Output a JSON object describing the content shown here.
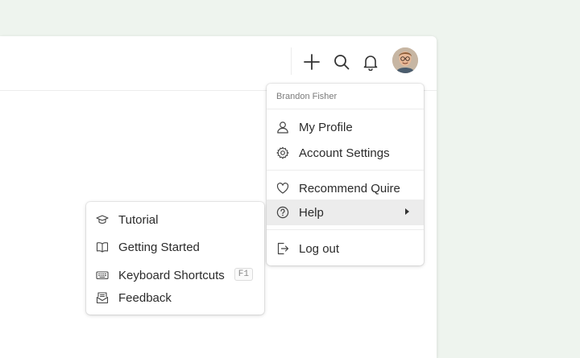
{
  "header": {
    "icons": [
      "plus-icon",
      "search-icon",
      "bell-icon"
    ],
    "avatar_alt": "user-avatar"
  },
  "user_menu": {
    "user_name": "Brandon Fisher",
    "items": [
      {
        "label": "My Profile",
        "icon": "person-icon"
      },
      {
        "label": "Account Settings",
        "icon": "gear-icon"
      },
      {
        "label": "Recommend Quire",
        "icon": "heart-icon"
      },
      {
        "label": "Help",
        "icon": "question-icon",
        "active": true
      },
      {
        "label": "Log out",
        "icon": "logout-icon"
      }
    ]
  },
  "help_menu": {
    "items": [
      {
        "label": "Tutorial",
        "icon": "graduation-cap-icon"
      },
      {
        "label": "Getting Started",
        "icon": "book-icon"
      },
      {
        "label": "Keyboard Shortcuts",
        "icon": "keyboard-icon",
        "shortcut": "F1"
      },
      {
        "label": "Feedback",
        "icon": "feedback-icon"
      }
    ]
  },
  "colors": {
    "page_bg": "#eef4ee",
    "panel_bg": "#ffffff",
    "active_item_bg": "#ececec",
    "text": "#2b2b2b",
    "muted_text": "#7b7b7b"
  }
}
